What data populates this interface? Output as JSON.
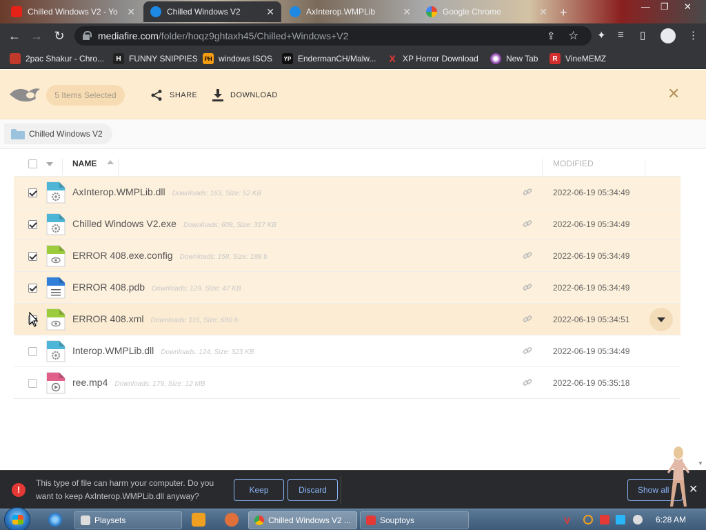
{
  "browser": {
    "tabs": [
      {
        "title": "Chilled Windows V2 - Yo",
        "active": false
      },
      {
        "title": "Chilled Windows V2",
        "active": true
      },
      {
        "title": "AxInterop.WMPLib",
        "active": false
      },
      {
        "title": "Google Chrome",
        "active": false
      }
    ],
    "url_domain": "mediafire.com",
    "url_path": "/folder/hoqz9ghtaxh45/Chilled+Windows+V2",
    "bookmarks": [
      {
        "label": "2pac Shakur - Chro...",
        "icon": "bookmark-2pac-icon",
        "color": "#c0392b",
        "glyph": ""
      },
      {
        "label": "FUNNY SNIPPIES",
        "icon": "bookmark-h-icon",
        "color": "#222222",
        "glyph": "H"
      },
      {
        "label": "windows ISOS",
        "icon": "bookmark-ph-icon",
        "color": "#f39c12",
        "glyph": "PH"
      },
      {
        "label": "EndermanCH/Malw...",
        "icon": "bookmark-yp-icon",
        "color": "#111111",
        "glyph": "YP"
      },
      {
        "label": "XP Horror Download",
        "icon": "bookmark-x-icon",
        "color": "#e53935",
        "glyph": "X"
      },
      {
        "label": "New Tab",
        "icon": "bookmark-newtab-icon",
        "color": "#8e44ad",
        "glyph": ""
      },
      {
        "label": "VineMEMZ",
        "icon": "bookmark-r-icon",
        "color": "#d32f2f",
        "glyph": "R"
      }
    ]
  },
  "mediafire": {
    "selection_label": "5 Items Selected",
    "share_label": "SHARE",
    "download_label": "DOWNLOAD",
    "breadcrumb": "Chilled Windows V2",
    "col_name": "NAME",
    "col_modified": "MODIFIED",
    "files": [
      {
        "name": "AxInterop.WMPLib.dll",
        "meta": "Downloads: 163, Size: 52 KB",
        "modified": "2022-06-19 05:34:49",
        "type": "dll",
        "checked": true
      },
      {
        "name": "Chilled Windows V2.exe",
        "meta": "Downloads: 608, Size: 317 KB",
        "modified": "2022-06-19 05:34:49",
        "type": "exe",
        "checked": true
      },
      {
        "name": "ERROR 408.exe.config",
        "meta": "Downloads: 158, Size: 188 b",
        "modified": "2022-06-19 05:34:49",
        "type": "config",
        "checked": true
      },
      {
        "name": "ERROR 408.pdb",
        "meta": "Downloads: 129, Size: 47 KB",
        "modified": "2022-06-19 05:34:49",
        "type": "pdb",
        "checked": true
      },
      {
        "name": "ERROR 408.xml",
        "meta": "Downloads: 116, Size: 680 b",
        "modified": "2022-06-19 05:34:51",
        "type": "xml",
        "checked": true
      },
      {
        "name": "Interop.WMPLib.dll",
        "meta": "Downloads: 124, Size: 323 KB",
        "modified": "2022-06-19 05:34:49",
        "type": "dll",
        "checked": false
      },
      {
        "name": "ree.mp4",
        "meta": "Downloads: 179, Size: 12 MB",
        "modified": "2022-06-19 05:35:18",
        "type": "mp4",
        "checked": false
      }
    ]
  },
  "download_bar": {
    "message": "This type of file can harm your computer. Do you want to keep AxInterop.WMPLib.dll anyway?",
    "keep_label": "Keep",
    "discard_label": "Discard",
    "show_all_label": "Show all"
  },
  "taskbar": {
    "items": [
      {
        "label": "Playsets",
        "active": false
      },
      {
        "label": "Chilled Windows V2 ...",
        "active": true
      },
      {
        "label": "Souptoys",
        "active": false
      }
    ],
    "clock": "6:28 AM"
  },
  "colors": {
    "selection_bar": "#fdecd0",
    "selected_row": "#fdf0dc",
    "chrome_dark": "#35363a",
    "link_blue": "#8ab4f8"
  }
}
